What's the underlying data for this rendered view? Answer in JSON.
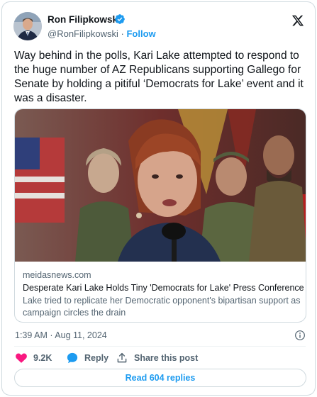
{
  "author": {
    "name": "Ron Filipkowski",
    "handle": "@RonFilipkowski",
    "separator": "·",
    "follow_label": "Follow"
  },
  "tweet": {
    "text": "Way behind in the polls, Kari Lake attempted to respond to the huge number of AZ Republicans supporting Gallego for Senate by holding a pitiful ‘Democrats for Lake’ event and it was a disaster."
  },
  "link_card": {
    "domain": "meidasnews.com",
    "title": "Desperate Kari Lake Holds Tiny 'Democrats for Lake' Press Conference",
    "description": "Lake tried to replicate her Democratic opponent's bipartisan support as campaign circles the drain"
  },
  "meta": {
    "timestamp": "1:39 AM · Aug 11, 2024"
  },
  "actions": {
    "like_count": "9.2K",
    "reply_label": "Reply",
    "share_label": "Share this post"
  },
  "read_replies_label": "Read 604 replies",
  "colors": {
    "accent": "#1d9bf0",
    "like": "#f91880",
    "text": "#0f1419",
    "muted": "#536471",
    "border": "#cfd9de"
  },
  "icons": {
    "verified": "verified-badge-icon",
    "brand": "x-logo-icon",
    "info": "info-icon",
    "like": "heart-icon",
    "reply": "speech-bubble-icon",
    "share": "share-arrow-icon"
  }
}
